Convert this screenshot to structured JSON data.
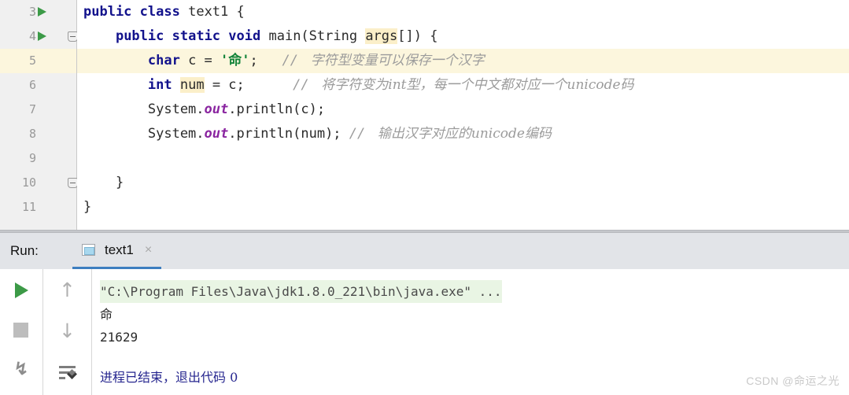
{
  "editor": {
    "lines": [
      {
        "number": "3",
        "run_marker": true,
        "fold": false,
        "active": false,
        "tokens": [
          {
            "t": "public",
            "c": "kw"
          },
          {
            "t": " ",
            "c": "plain"
          },
          {
            "t": "class",
            "c": "kw"
          },
          {
            "t": " text1 {",
            "c": "plain"
          }
        ]
      },
      {
        "number": "4",
        "run_marker": true,
        "fold": true,
        "active": false,
        "tokens": [
          {
            "t": "    ",
            "c": "plain"
          },
          {
            "t": "public",
            "c": "kw"
          },
          {
            "t": " ",
            "c": "plain"
          },
          {
            "t": "static",
            "c": "kw"
          },
          {
            "t": " ",
            "c": "plain"
          },
          {
            "t": "void",
            "c": "kw"
          },
          {
            "t": " main(String ",
            "c": "plain"
          },
          {
            "t": "args",
            "c": "plain hl"
          },
          {
            "t": "[]) {",
            "c": "plain"
          }
        ]
      },
      {
        "number": "5",
        "run_marker": false,
        "fold": false,
        "active": true,
        "tokens": [
          {
            "t": "        ",
            "c": "plain"
          },
          {
            "t": "char",
            "c": "kw"
          },
          {
            "t": " c = ",
            "c": "plain"
          },
          {
            "t": "'命'",
            "c": "str"
          },
          {
            "t": ";   ",
            "c": "plain"
          },
          {
            "t": "// ",
            "c": "cmt-slash"
          },
          {
            "t": " 字符型变量可以保存一个汉字",
            "c": "cmt"
          }
        ]
      },
      {
        "number": "6",
        "run_marker": false,
        "fold": false,
        "active": false,
        "tokens": [
          {
            "t": "        ",
            "c": "plain"
          },
          {
            "t": "int",
            "c": "kw"
          },
          {
            "t": " ",
            "c": "plain"
          },
          {
            "t": "num",
            "c": "plain hl"
          },
          {
            "t": " = c;      ",
            "c": "plain"
          },
          {
            "t": "// ",
            "c": "cmt-slash"
          },
          {
            "t": " 将字符变为int型，每一个中文都对应一个unicode码",
            "c": "cmt"
          }
        ]
      },
      {
        "number": "7",
        "run_marker": false,
        "fold": false,
        "active": false,
        "tokens": [
          {
            "t": "        System.",
            "c": "plain"
          },
          {
            "t": "out",
            "c": "fld"
          },
          {
            "t": ".println(c);",
            "c": "plain"
          }
        ]
      },
      {
        "number": "8",
        "run_marker": false,
        "fold": false,
        "active": false,
        "tokens": [
          {
            "t": "        System.",
            "c": "plain"
          },
          {
            "t": "out",
            "c": "fld"
          },
          {
            "t": ".println(num); ",
            "c": "plain"
          },
          {
            "t": "// ",
            "c": "cmt-slash"
          },
          {
            "t": " 输出汉字对应的unicode编码",
            "c": "cmt"
          }
        ]
      },
      {
        "number": "9",
        "run_marker": false,
        "fold": false,
        "active": false,
        "tokens": []
      },
      {
        "number": "10",
        "run_marker": false,
        "fold": true,
        "active": false,
        "tokens": [
          {
            "t": "    }",
            "c": "plain"
          }
        ]
      },
      {
        "number": "11",
        "run_marker": false,
        "fold": false,
        "active": false,
        "tokens": [
          {
            "t": "}",
            "c": "plain"
          }
        ]
      }
    ]
  },
  "run_panel": {
    "label": "Run:",
    "tab": {
      "name": "text1",
      "icon": "console-window-icon",
      "close": "×"
    },
    "toolbar": {
      "rerun": "rerun-icon",
      "stop": "stop-icon",
      "trace": "trace-icon",
      "up": "↑",
      "down": "↓",
      "soft_wrap": "soft-wrap-icon"
    },
    "console": {
      "command": "\"C:\\Program Files\\Java\\jdk1.8.0_221\\bin\\java.exe\" ...",
      "output_char": "命",
      "output_num": "21629",
      "exit_message": "进程已结束，退出代码 0"
    }
  },
  "watermark": "CSDN @命运之光",
  "colors": {
    "keyword": "#12128c",
    "string": "#13843a",
    "field": "#8a25a0",
    "comment": "#9b9b9b",
    "highlight_line": "#fcf6dd",
    "token_highlight": "#fbefc9",
    "tab_underline": "#3d7ec0",
    "console_command_bg": "#e9f5e4",
    "exit_text": "#26268f",
    "run_green": "#3c9a47"
  }
}
